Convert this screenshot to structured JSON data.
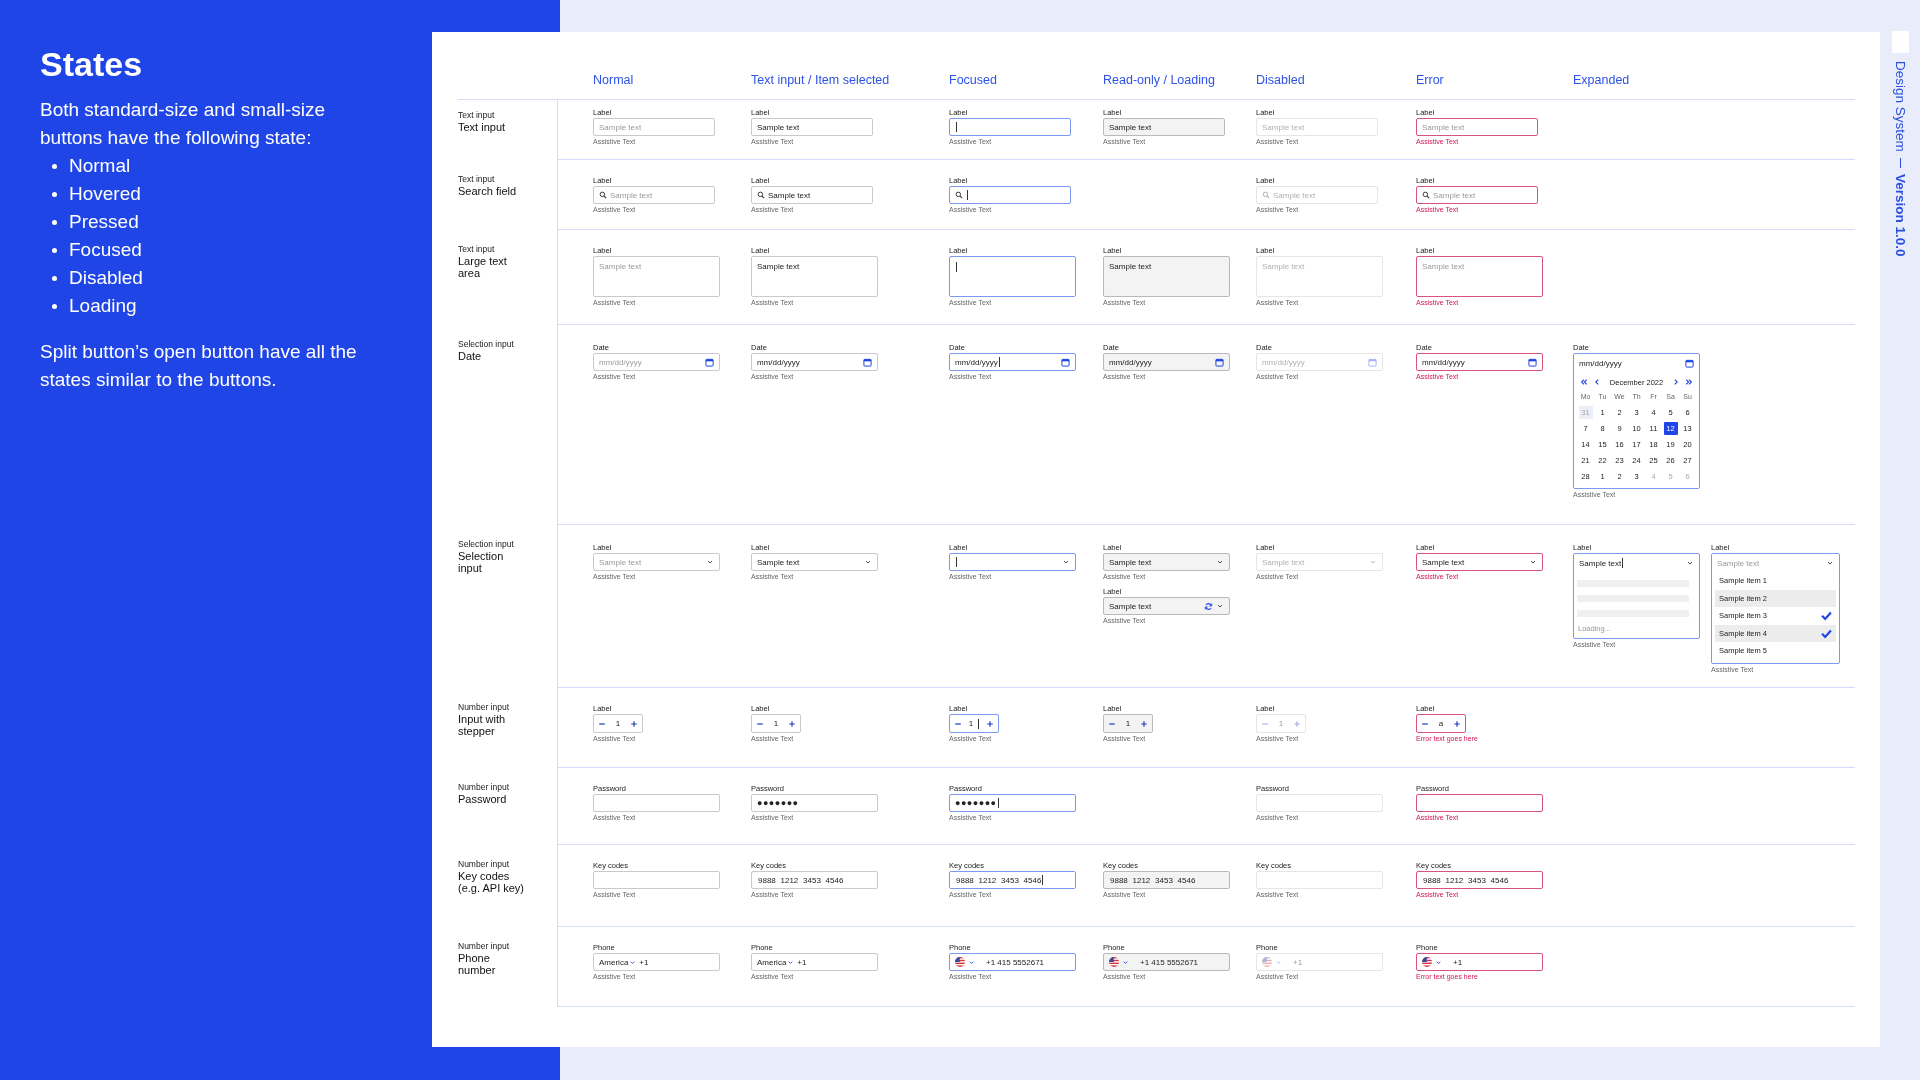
{
  "intro": {
    "title": "States",
    "text": "Both standard-size and small-size buttons have the following state:",
    "items": [
      "Normal",
      "Hovered",
      "Pressed",
      "Focused",
      "Disabled",
      "Loading"
    ],
    "note": "Split button’s open button have all the states similar to the buttons."
  },
  "columns": [
    {
      "kind": "normal",
      "header": "Normal"
    },
    {
      "kind": "filled",
      "header": "Text input / Item selected"
    },
    {
      "kind": "focused",
      "header": "Focused"
    },
    {
      "kind": "readonly",
      "header": "Read-only / Loading"
    },
    {
      "kind": "disabled",
      "header": "Disabled"
    },
    {
      "kind": "error",
      "header": "Error"
    },
    {
      "kind": "expanded",
      "header": "Expanded"
    }
  ],
  "rows": [
    {
      "kind": "text",
      "category": "Text input",
      "title": "Text input",
      "cells": {
        "normal": [
          {
            "label": "Label",
            "placeholder": "Sample text",
            "cursor": false,
            "assistive": "Assistive Text"
          }
        ],
        "filled": [
          {
            "label": "Label",
            "value": "Sample text",
            "cursor": false,
            "assistive": "Assistive Text"
          }
        ],
        "focused": [
          {
            "label": "Label",
            "cursor": true,
            "assistive": "Assistive Text"
          }
        ],
        "readonly": [
          {
            "label": "Label",
            "value": "Sample text",
            "cursor": false,
            "assistive": "Assistive Text"
          }
        ],
        "disabled": [
          {
            "label": "Label",
            "placeholder": "Sample text",
            "cursor": false,
            "assistive": "Assistive Text"
          }
        ],
        "error": [
          {
            "label": "Label",
            "placeholder": "Sample text",
            "cursor": false,
            "assistive": "Assistive Text"
          }
        ]
      }
    },
    {
      "kind": "search",
      "category": "Text input",
      "title": "Search field",
      "cells": {
        "normal": [
          {
            "label": "Label",
            "placeholder": "Sample text",
            "cursor": false,
            "assistive": "Assistive Text"
          }
        ],
        "filled": [
          {
            "label": "Label",
            "value": "Sample text",
            "cursor": false,
            "assistive": "Assistive Text"
          }
        ],
        "focused": [
          {
            "label": "Label",
            "cursor": true,
            "assistive": "Assistive Text"
          }
        ],
        "disabled": [
          {
            "label": "Label",
            "placeholder": "Sample text",
            "cursor": false,
            "assistive": "Assistive Text"
          }
        ],
        "error": [
          {
            "label": "Label",
            "placeholder": "Sample text",
            "cursor": false,
            "assistive": "Assistive Text"
          }
        ]
      }
    },
    {
      "kind": "textarea",
      "category": "Text input",
      "title": "Large text area",
      "cells": {
        "normal": [
          {
            "label": "Label",
            "placeholder": "Sample text",
            "cursor": false,
            "assistive": "Assistive Text"
          }
        ],
        "filled": [
          {
            "label": "Label",
            "value": "Sample text",
            "cursor": false,
            "assistive": "Assistive Text"
          }
        ],
        "focused": [
          {
            "label": "Label",
            "cursor": true,
            "assistive": "Assistive Text"
          }
        ],
        "readonly": [
          {
            "label": "Label",
            "value": "Sample text",
            "cursor": false,
            "assistive": "Assistive Text"
          }
        ],
        "disabled": [
          {
            "label": "Label",
            "placeholder": "Sample text",
            "cursor": false,
            "assistive": "Assistive Text"
          }
        ],
        "error": [
          {
            "label": "Label",
            "placeholder": "Sample text",
            "cursor": false,
            "assistive": "Assistive Text"
          }
        ]
      }
    },
    {
      "kind": "date",
      "category": "Selection input",
      "title": "Date",
      "cells": {
        "normal": [
          {
            "label": "Date",
            "placeholder": "mm/dd/yyyy",
            "cursor": false,
            "assistive": "Assistive Text"
          }
        ],
        "filled": [
          {
            "label": "Date",
            "value": "mm/dd/yyyy",
            "cursor": false,
            "assistive": "Assistive Text"
          }
        ],
        "focused": [
          {
            "label": "Date",
            "value": "mm/dd/yyyy",
            "cursor": true,
            "assistive": "Assistive Text"
          }
        ],
        "readonly": [
          {
            "label": "Date",
            "value": "mm/dd/yyyy",
            "cursor": false,
            "assistive": "Assistive Text"
          }
        ],
        "disabled": [
          {
            "label": "Date",
            "placeholder": "mm/dd/yyyy",
            "cursor": false,
            "assistive": "Assistive Text"
          }
        ],
        "error": [
          {
            "label": "Date",
            "value": "mm/dd/yyyy",
            "cursor": false,
            "assistive": "Assistive Text"
          }
        ],
        "expanded": [
          {
            "label": "Date",
            "value": "mm/dd/yyyy",
            "cursor": false,
            "assistive": "Assistive Text",
            "calendar": {
              "month": "December 2022",
              "weekdays": [
                "Mo",
                "Tu",
                "We",
                "Th",
                "Fr",
                "Sa",
                "Su"
              ],
              "weeks": [
                [
                  {
                    "day": "31",
                    "outside": true,
                    "hovered": true,
                    "selected": false
                  },
                  {
                    "day": "1",
                    "outside": false,
                    "hovered": false,
                    "selected": false
                  },
                  {
                    "day": "2",
                    "outside": false,
                    "hovered": false,
                    "selected": false
                  },
                  {
                    "day": "3",
                    "outside": false,
                    "hovered": false,
                    "selected": false
                  },
                  {
                    "day": "4",
                    "outside": false,
                    "hovered": false,
                    "selected": false
                  },
                  {
                    "day": "5",
                    "outside": false,
                    "hovered": false,
                    "selected": false
                  },
                  {
                    "day": "6",
                    "outside": false,
                    "hovered": false,
                    "selected": false
                  }
                ],
                [
                  {
                    "day": "7",
                    "outside": false,
                    "hovered": false,
                    "selected": false
                  },
                  {
                    "day": "8",
                    "outside": false,
                    "hovered": false,
                    "selected": false
                  },
                  {
                    "day": "9",
                    "outside": false,
                    "hovered": false,
                    "selected": false
                  },
                  {
                    "day": "10",
                    "outside": false,
                    "hovered": false,
                    "selected": false
                  },
                  {
                    "day": "11",
                    "outside": false,
                    "hovered": false,
                    "selected": false
                  },
                  {
                    "day": "12",
                    "outside": false,
                    "hovered": false,
                    "selected": true
                  },
                  {
                    "day": "13",
                    "outside": false,
                    "hovered": false,
                    "selected": false
                  }
                ],
                [
                  {
                    "day": "14",
                    "outside": false,
                    "hovered": false,
                    "selected": false
                  },
                  {
                    "day": "15",
                    "outside": false,
                    "hovered": false,
                    "selected": false
                  },
                  {
                    "day": "16",
                    "outside": false,
                    "hovered": false,
                    "selected": false
                  },
                  {
                    "day": "17",
                    "outside": false,
                    "hovered": false,
                    "selected": false
                  },
                  {
                    "day": "18",
                    "outside": false,
                    "hovered": false,
                    "selected": false
                  },
                  {
                    "day": "19",
                    "outside": false,
                    "hovered": false,
                    "selected": false
                  },
                  {
                    "day": "20",
                    "outside": false,
                    "hovered": false,
                    "selected": false
                  }
                ],
                [
                  {
                    "day": "21",
                    "outside": false,
                    "hovered": false,
                    "selected": false
                  },
                  {
                    "day": "22",
                    "outside": false,
                    "hovered": false,
                    "selected": false
                  },
                  {
                    "day": "23",
                    "outside": false,
                    "hovered": false,
                    "selected": false
                  },
                  {
                    "day": "24",
                    "outside": false,
                    "hovered": false,
                    "selected": false
                  },
                  {
                    "day": "25",
                    "outside": false,
                    "hovered": false,
                    "selected": false
                  },
                  {
                    "day": "26",
                    "outside": false,
                    "hovered": false,
                    "selected": false
                  },
                  {
                    "day": "27",
                    "outside": false,
                    "hovered": false,
                    "selected": false
                  }
                ],
                [
                  {
                    "day": "28",
                    "outside": false,
                    "hovered": false,
                    "selected": false
                  },
                  {
                    "day": "1",
                    "outside": false,
                    "hovered": false,
                    "selected": false
                  },
                  {
                    "day": "2",
                    "outside": false,
                    "hovered": false,
                    "selected": false
                  },
                  {
                    "day": "3",
                    "outside": false,
                    "hovered": false,
                    "selected": false
                  },
                  {
                    "day": "4",
                    "outside": true,
                    "hovered": false,
                    "selected": false
                  },
                  {
                    "day": "5",
                    "outside": true,
                    "hovered": false,
                    "selected": false
                  },
                  {
                    "day": "6",
                    "outside": true,
                    "hovered": false,
                    "selected": false
                  }
                ]
              ]
            }
          }
        ]
      }
    },
    {
      "kind": "select",
      "category": "Selection input",
      "title": "Selection input",
      "cells": {
        "normal": [
          {
            "label": "Label",
            "placeholder": "Sample text",
            "cursor": false,
            "loading": false,
            "assistive": "Assistive Text"
          }
        ],
        "filled": [
          {
            "label": "Label",
            "value": "Sample text",
            "cursor": false,
            "loading": false,
            "assistive": "Assistive Text"
          }
        ],
        "focused": [
          {
            "label": "Label",
            "cursor": true,
            "loading": false,
            "assistive": "Assistive Text"
          }
        ],
        "readonly": [
          {
            "label": "Label",
            "value": "Sample text",
            "cursor": false,
            "loading": false,
            "assistive": "Assistive Text"
          },
          {
            "label": "Label",
            "value": "Sample text",
            "cursor": false,
            "loading": true,
            "assistive": "Assistive Text"
          }
        ],
        "disabled": [
          {
            "label": "Label",
            "placeholder": "Sample text",
            "cursor": false,
            "loading": false,
            "assistive": "Assistive Text"
          }
        ],
        "error": [
          {
            "label": "Label",
            "value": "Sample text",
            "cursor": false,
            "loading": false,
            "assistive": "Assistive Text"
          }
        ],
        "expanded": [
          {
            "label": "Label",
            "value": "Sample text",
            "cursor": true,
            "loading": false,
            "assistive": "Assistive Text",
            "menu": {
              "kind": "loading",
              "text": "Loading..."
            }
          },
          {
            "label": "Label",
            "placeholder": "Sample text",
            "cursor": false,
            "loading": false,
            "assistive": "Assistive Text",
            "menu": {
              "kind": "options",
              "items": [
                {
                  "label": "Sample item 1",
                  "selected": false,
                  "hovered": false
                },
                {
                  "label": "Sample item 2",
                  "selected": false,
                  "hovered": true
                },
                {
                  "label": "Sample item 3",
                  "selected": true,
                  "hovered": false
                },
                {
                  "label": "Sample item 4",
                  "selected": true,
                  "hovered": true
                },
                {
                  "label": "Sample item 5",
                  "selected": false,
                  "hovered": false
                }
              ]
            }
          }
        ]
      }
    },
    {
      "kind": "stepper",
      "category": "Number input",
      "title": "Input with stepper",
      "cells": {
        "normal": [
          {
            "label": "Label",
            "value": "1",
            "cursor": false,
            "assistive": "Assistive Text"
          }
        ],
        "filled": [
          {
            "label": "Label",
            "value": "1",
            "cursor": false,
            "assistive": "Assistive Text"
          }
        ],
        "focused": [
          {
            "label": "Label",
            "value": "1",
            "cursor": true,
            "assistive": "Assistive Text"
          }
        ],
        "readonly": [
          {
            "label": "Label",
            "value": "1",
            "cursor": false,
            "assistive": "Assistive Text"
          }
        ],
        "disabled": [
          {
            "label": "Label",
            "value": "1",
            "cursor": false,
            "assistive": "Assistive Text"
          }
        ],
        "error": [
          {
            "label": "Label",
            "value": "a",
            "cursor": false,
            "assistive": "Error text goes here"
          }
        ]
      }
    },
    {
      "kind": "password",
      "category": "Number input",
      "title": "Password",
      "cells": {
        "normal": [
          {
            "label": "Password",
            "cursor": false,
            "assistive": "Assistive Text"
          }
        ],
        "filled": [
          {
            "label": "Password",
            "value": "●●●●●●●",
            "cursor": false,
            "assistive": "Assistive Text"
          }
        ],
        "focused": [
          {
            "label": "Password",
            "value": "●●●●●●●",
            "cursor": true,
            "assistive": "Assistive Text"
          }
        ],
        "disabled": [
          {
            "label": "Password",
            "cursor": false,
            "assistive": "Assistive Text"
          }
        ],
        "error": [
          {
            "label": "Password",
            "cursor": false,
            "assistive": "Assistive Text"
          }
        ]
      }
    },
    {
      "kind": "keycode",
      "category": "Number input",
      "title": "Key codes (e.g. API key)",
      "cells": {
        "normal": [
          {
            "label": "Key codes",
            "cursor": false,
            "assistive": "Assistive Text"
          }
        ],
        "filled": [
          {
            "label": "Key codes",
            "value": "9888 1212 3453 4546",
            "cursor": false,
            "assistive": "Assistive Text"
          }
        ],
        "focused": [
          {
            "label": "Key codes",
            "value": "9888 1212 3453 4546",
            "cursor": true,
            "assistive": "Assistive Text"
          }
        ],
        "readonly": [
          {
            "label": "Key codes",
            "value": "9888 1212 3453 4546",
            "cursor": false,
            "assistive": "Assistive Text"
          }
        ],
        "disabled": [
          {
            "label": "Key codes",
            "cursor": false,
            "assistive": "Assistive Text"
          }
        ],
        "error": [
          {
            "label": "Key codes",
            "value": "9888 1212 3453 4546",
            "cursor": false,
            "assistive": "Assistive Text"
          }
        ]
      }
    },
    {
      "kind": "phone",
      "category": "Number input",
      "title": "Phone number",
      "cells": {
        "normal": [
          {
            "label": "Phone",
            "kind": "text",
            "country": "America",
            "value": "+1",
            "cursor": false,
            "assistive": "Assistive Text"
          }
        ],
        "filled": [
          {
            "label": "Phone",
            "kind": "text",
            "country": "America",
            "value": "+1",
            "cursor": false,
            "assistive": "Assistive Text"
          }
        ],
        "focused": [
          {
            "label": "Phone",
            "kind": "flag",
            "value": "+1 415 5552671",
            "cursor": false,
            "assistive": "Assistive Text"
          }
        ],
        "readonly": [
          {
            "label": "Phone",
            "kind": "flag",
            "value": "+1 415 5552671",
            "cursor": false,
            "assistive": "Assistive Text"
          }
        ],
        "disabled": [
          {
            "label": "Phone",
            "kind": "flag",
            "value": "+1",
            "cursor": false,
            "assistive": "Assistive Text"
          }
        ],
        "error": [
          {
            "label": "Phone",
            "kind": "flag",
            "value": "+1",
            "cursor": false,
            "assistive": "Error text goes here"
          }
        ]
      }
    }
  ],
  "side": {
    "title": "Design System",
    "version": "Version 1.0.0"
  }
}
